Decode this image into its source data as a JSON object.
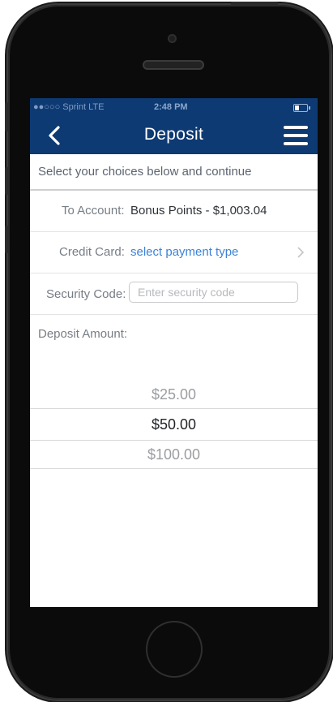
{
  "status_bar": {
    "carrier": "●●○○○ Sprint  LTE",
    "time": "2:48 PM",
    "battery_fraction": 0.35
  },
  "nav": {
    "title": "Deposit",
    "back_icon": "chevron-left-icon",
    "menu_icon": "hamburger-menu-icon"
  },
  "instructions": "Select your choices below and continue",
  "to_account": {
    "label": "To Account:",
    "value": "Bonus Points - $1,003.04"
  },
  "credit_card": {
    "label": "Credit Card:",
    "value": "select payment type"
  },
  "security_code": {
    "label": "Security Code:",
    "placeholder": "Enter security code",
    "value": ""
  },
  "deposit_amount": {
    "label": "Deposit Amount:",
    "options": [
      "$25.00",
      "$50.00",
      "$100.00"
    ],
    "selected": "$50.00"
  },
  "colors": {
    "nav_blue": "#0e3a73",
    "link_blue": "#3d82d6"
  }
}
